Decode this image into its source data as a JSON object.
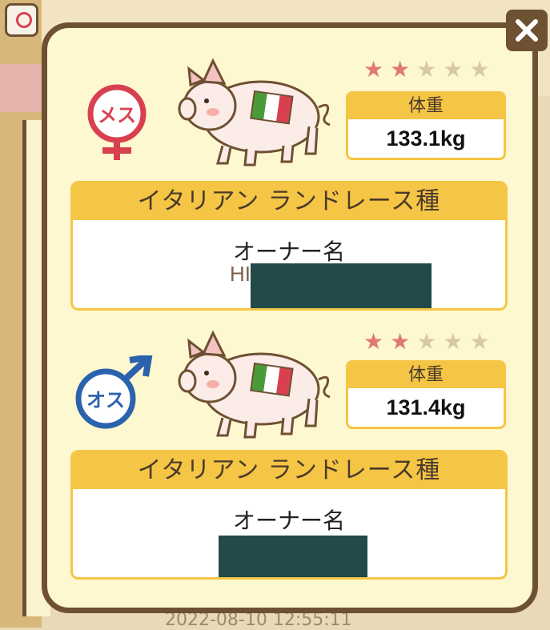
{
  "background": {
    "bottom_timestamp": "2022-08-10 12:55:11"
  },
  "dialog": {
    "close_icon": "close-icon",
    "pigs": [
      {
        "sex_label": "メス",
        "sex_color": "#d9404f",
        "flag": "italy-flag",
        "stars_filled": 2,
        "stars_total": 5,
        "weight_label": "体重",
        "weight_value": "133.1kg",
        "breed": "イタリアン ランドレース種",
        "owner_label": "オーナー名",
        "owner_name": "HI"
      },
      {
        "sex_label": "オス",
        "sex_color": "#2a62ad",
        "flag": "italy-flag",
        "stars_filled": 2,
        "stars_total": 5,
        "weight_label": "体重",
        "weight_value": "131.4kg",
        "breed": "イタリアン ランドレース種",
        "owner_label": "オーナー名",
        "owner_name": ""
      }
    ]
  },
  "colors": {
    "star_on": "#e07a6f",
    "star_off": "#d9c9a0",
    "accent": "#f5c545",
    "frame": "#6e5032"
  }
}
